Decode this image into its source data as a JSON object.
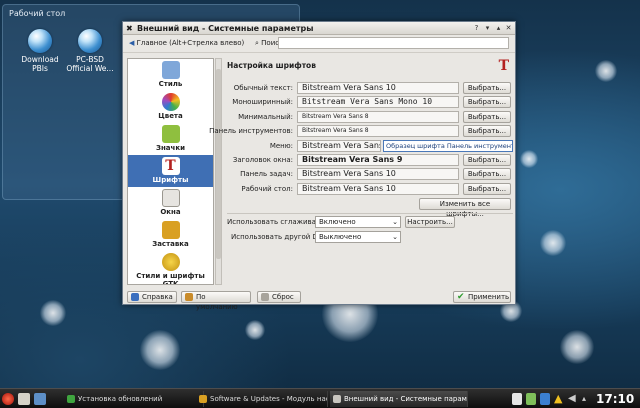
{
  "desktop": {
    "panel_title": "Рабочий стол",
    "icons": [
      {
        "label": "Download PBIs"
      },
      {
        "label": "PC-BSD Official We..."
      }
    ]
  },
  "window": {
    "title": "Внешний вид - Системные параметры",
    "toolbar": {
      "home_label": "Главное (Alt+Стрелка влево)",
      "search_label": "Поиск:",
      "search_value": ""
    },
    "sidebar": [
      {
        "label": "Стиль",
        "icon": "style-icon",
        "color": "#7fa7d9"
      },
      {
        "label": "Цвета",
        "icon": "colors-icon",
        "color": "#e08a2c"
      },
      {
        "label": "Значки",
        "icon": "icons-icon",
        "color": "#8fbf3f"
      },
      {
        "label": "Шрифты",
        "icon": "fonts-icon",
        "color": "#b3201f",
        "selected": true
      },
      {
        "label": "Окна",
        "icon": "windows-icon",
        "color": "#c9c6c0"
      },
      {
        "label": "Заставка",
        "icon": "splash-icon",
        "color": "#d9a023"
      },
      {
        "label": "Стили и шрифты GTK",
        "icon": "gtk-icon",
        "color": "#e6c21f"
      }
    ],
    "content": {
      "section_title": "Настройка шрифтов",
      "fonts": [
        {
          "label": "Обычный текст:",
          "value": "Bitstream Vera Sans 10"
        },
        {
          "label": "Моноширинный:",
          "value": "Bitstream Vera Sans Mono 10"
        },
        {
          "label": "Минимальный:",
          "value": "Bitstream Vera Sans 8"
        },
        {
          "label": "Панель инструментов:",
          "value": "Bitstream Vera Sans 8"
        },
        {
          "label": "Меню:",
          "value": "Bitstream Vera Sans 10"
        },
        {
          "label": "Заголовок окна:",
          "value": "Bitstream Vera Sans 9"
        },
        {
          "label": "Панель задач:",
          "value": "Bitstream Vera Sans 10"
        },
        {
          "label": "Рабочий стол:",
          "value": "Bitstream Vera Sans 10"
        }
      ],
      "choose_label": "Выбрать...",
      "menu_preview": "Образец шрифта Панель инструментов",
      "change_all_label": "Изменить все шрифты...",
      "antialias_label": "Использовать сглаживание:",
      "antialias_value": "Включено",
      "configure_label": "Настроить...",
      "dpi_label": "Использовать другой DPI:",
      "dpi_value": "Выключено"
    },
    "buttons": {
      "help": "Справка",
      "defaults": "По умолчанию",
      "reset": "Сброс",
      "apply": "Применить"
    }
  },
  "taskbar": {
    "tasks": [
      {
        "label": "Установка обновлений"
      },
      {
        "label": "Software & Updates - Модуль наст"
      },
      {
        "label": "Внешний вид - Системные параметр"
      }
    ],
    "clock": "17:10"
  }
}
